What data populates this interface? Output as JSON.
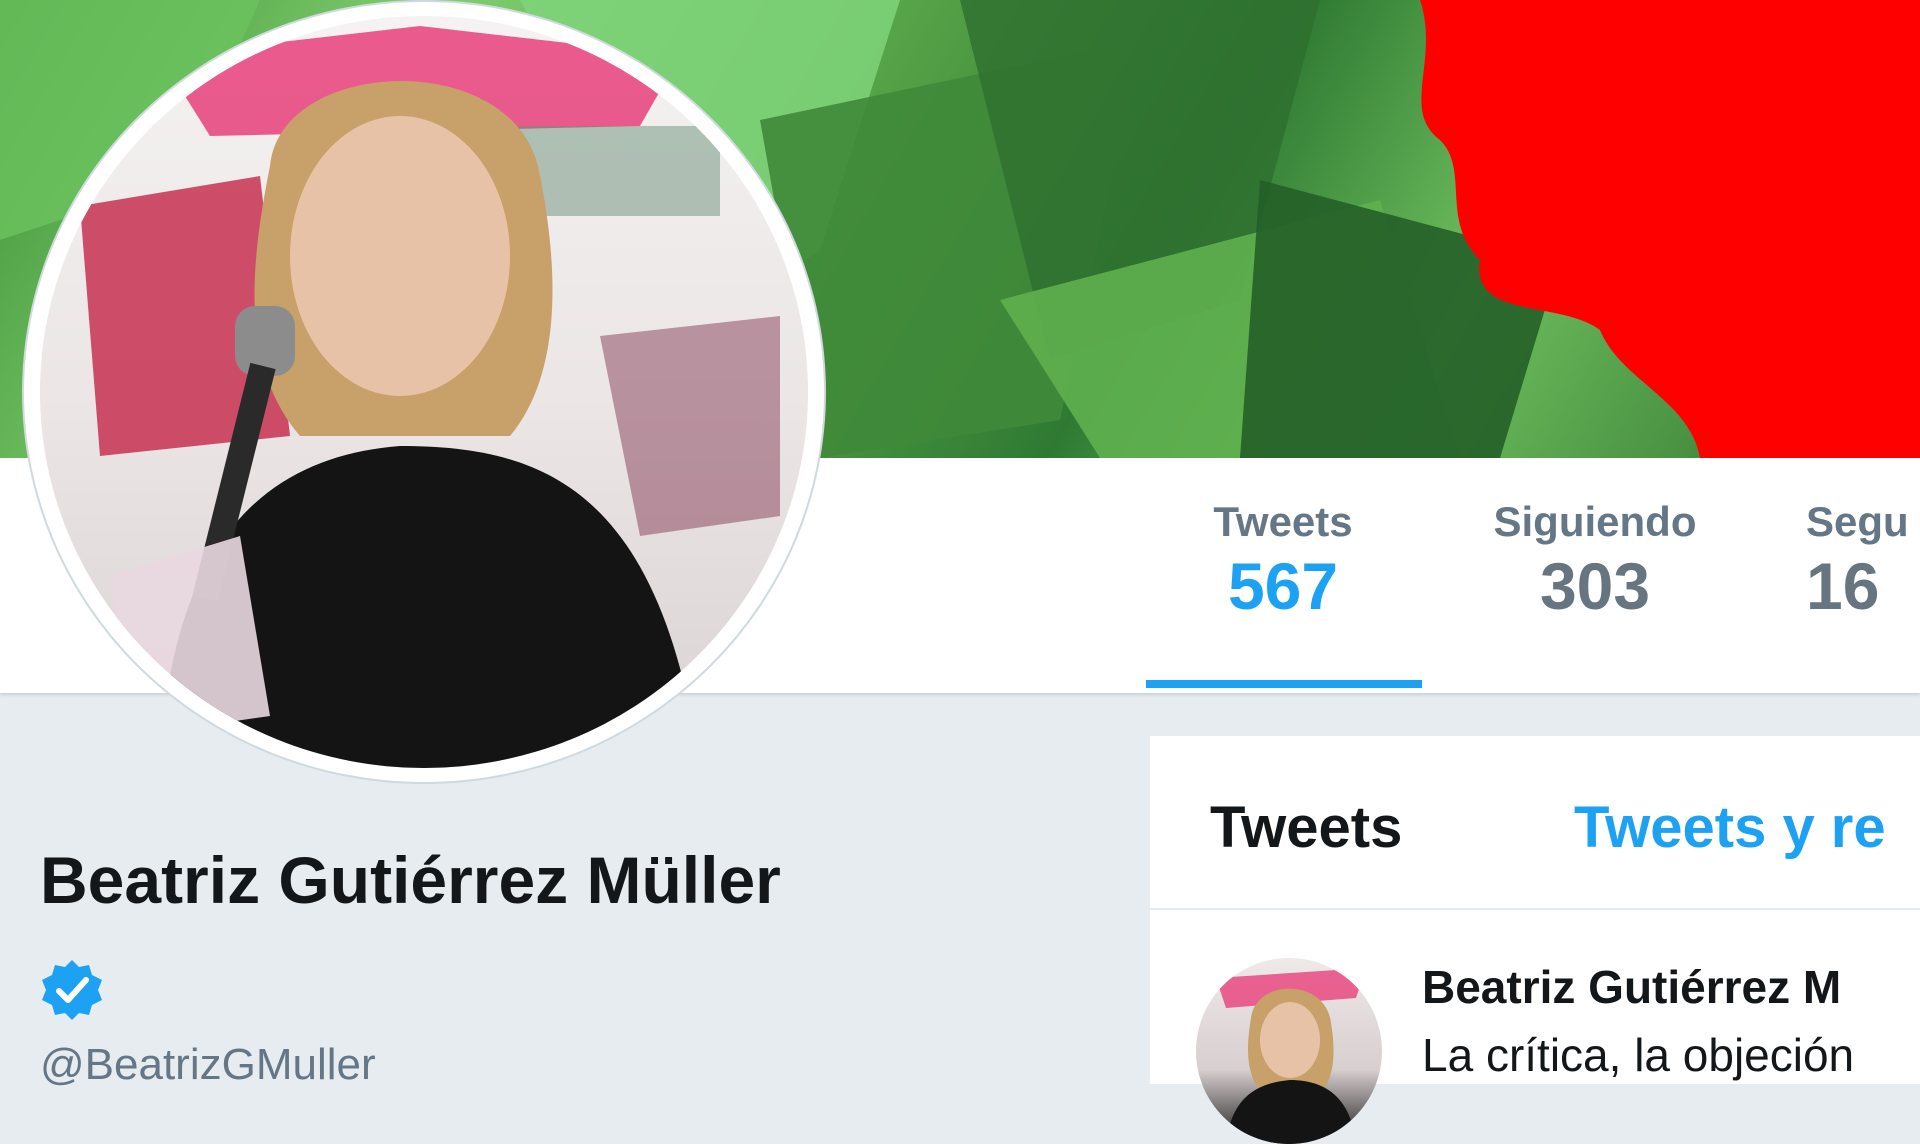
{
  "profile": {
    "name": "Beatriz Gutiérrez Müller",
    "handle": "@BeatrizGMuller",
    "verified": true
  },
  "stats": [
    {
      "label": "Tweets",
      "value": "567",
      "active": true
    },
    {
      "label": "Siguiendo",
      "value": "303",
      "active": false
    },
    {
      "label": "Segu",
      "value": "16",
      "active": false
    }
  ],
  "timeline": {
    "tabs": [
      {
        "label": "Tweets",
        "active": true
      },
      {
        "label": "Tweets y re",
        "active": false
      }
    ],
    "first_tweet": {
      "author": "Beatriz Gutiérrez M",
      "text": "La crítica, la objeción"
    }
  },
  "colors": {
    "accent": "#1da1f2",
    "stat_label": "#657786",
    "text_dark": "#14171a",
    "banner_red": "#ff0000",
    "banner_green": "#4e9e3f"
  }
}
